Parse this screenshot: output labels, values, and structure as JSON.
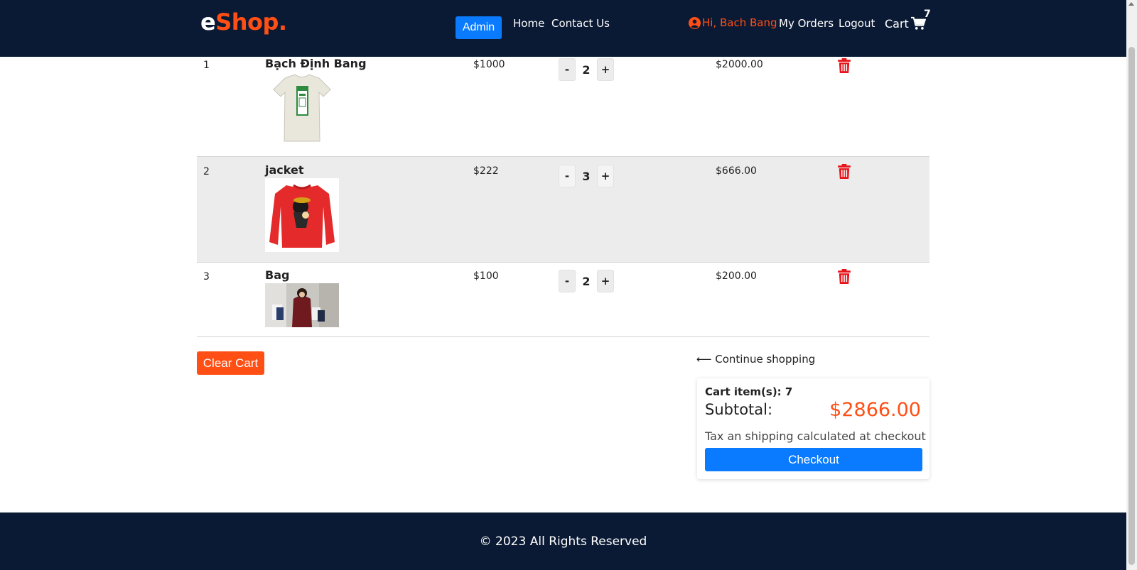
{
  "header": {
    "logo": {
      "e": "e",
      "shop": "Shop",
      "dot": "."
    },
    "admin_label": "Admin",
    "nav": {
      "home": "Home",
      "contact": "Contact Us"
    },
    "greeting": "Hi, Bach Bang",
    "my_orders": "My Orders",
    "logout": "Logout",
    "cart_label": "Cart",
    "cart_count": "7"
  },
  "cart": {
    "items": [
      {
        "index": "1",
        "name": "Bạch Định Bang",
        "price": "$1000",
        "quantity": "2",
        "total": "$2000.00",
        "image": "white-tshirt"
      },
      {
        "index": "2",
        "name": "jacket",
        "price": "$222",
        "quantity": "3",
        "total": "$666.00",
        "image": "red-sweatshirt"
      },
      {
        "index": "3",
        "name": "Bag",
        "price": "$100",
        "quantity": "2",
        "total": "$200.00",
        "image": "shopping-woman-photo"
      }
    ],
    "decrement": "-",
    "increment": "+"
  },
  "actions": {
    "clear_cart": "Clear Cart",
    "continue_shopping": "⟵ Continue shopping"
  },
  "summary": {
    "items_label": "Cart item(s): 7",
    "subtotal_label": "Subtotal:",
    "subtotal_value": "$2866.00",
    "tax_note": "Tax an shipping calculated at checkout",
    "checkout": "Checkout"
  },
  "footer": {
    "copyright": "© 2023 All Rights Reserved"
  },
  "colors": {
    "navy": "#0b1a34",
    "accent": "#ff4f14",
    "primary": "#0a7bff",
    "danger": "#e8141b"
  }
}
